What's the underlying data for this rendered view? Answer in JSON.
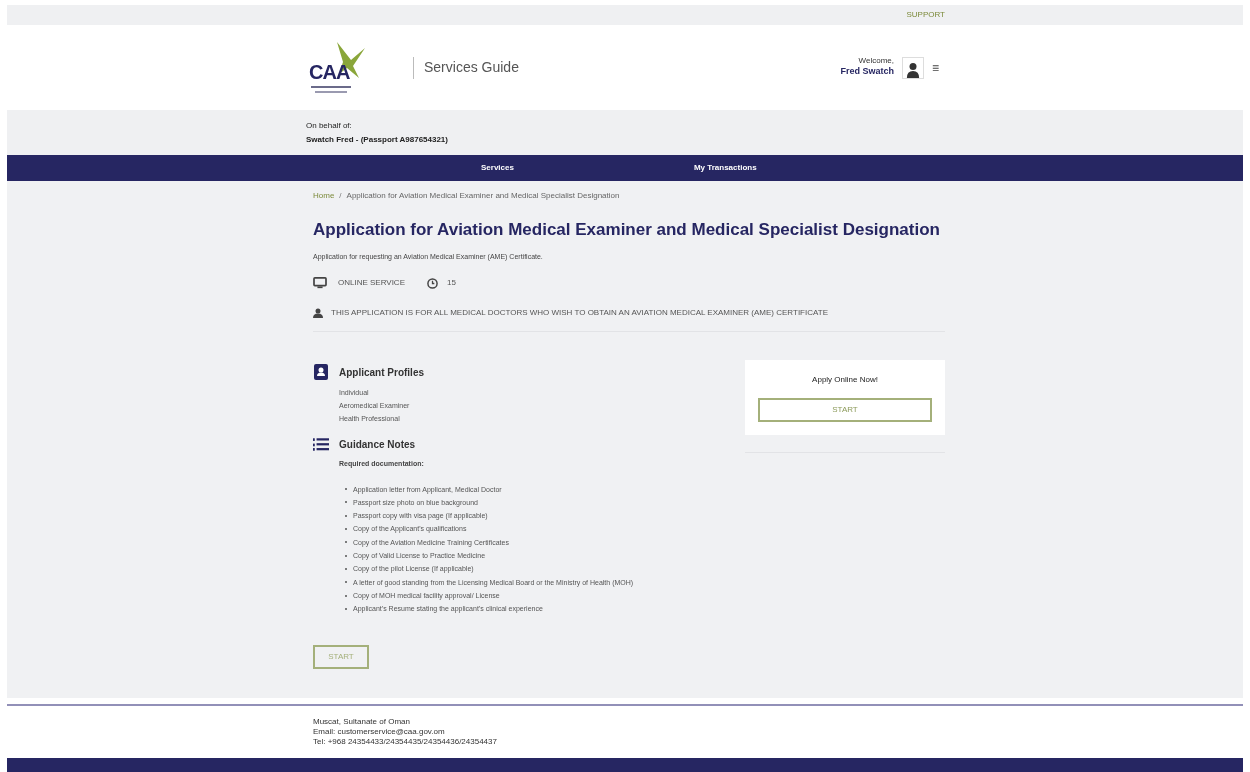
{
  "top_bar": {
    "link": "SUPPORT"
  },
  "header": {
    "logo_text": "CAA",
    "title": "Services Guide",
    "welcome": "Welcome,",
    "user_name": "Fred Swatch",
    "menu_glyph": "≡"
  },
  "behalf": {
    "label": "On behalf of:",
    "value": "Swatch Fred - (Passport A987654321)"
  },
  "nav": [
    {
      "label": "Services"
    },
    {
      "label": "My Transactions"
    }
  ],
  "breadcrumb": {
    "separator": "/",
    "items": [
      "Home",
      "Application for Aviation Medical Examiner and Medical Specialist Designation"
    ]
  },
  "service": {
    "title": "Application for Aviation Medical Examiner and Medical Specialist Designation",
    "description": "Application for requesting an Aviation Medical Examiner (AME) Certificate.",
    "mode": "ONLINE SERVICE",
    "duration": "15",
    "audience": "THIS APPLICATION IS FOR ALL MEDICAL DOCTORS WHO WISH TO OBTAIN AN AVIATION MEDICAL EXAMINER (AME) CERTIFICATE"
  },
  "profiles": {
    "heading": "Applicant Profiles",
    "items": [
      "Individual",
      "Aeromedical Examiner",
      "Health Professional"
    ]
  },
  "guidance": {
    "heading": "Guidance Notes",
    "subheading": "Required documentation:",
    "items": [
      "Application letter from Applicant, Medical Doctor",
      "Passport size photo on blue background",
      "Passport copy with visa page (If applicable)",
      "Copy of the Applicant's qualifications",
      "Copy of the Aviation Medicine Training Certificates",
      "Copy of Valid License to Practice Medicine",
      "Copy of the pilot License (If applicable)",
      "A letter of good standing from the Licensing Medical Board or the Ministry of Health (MOH)",
      "Copy of MOH medical facility approval/ License",
      "Applicant's Resume stating the applicant's clinical experience"
    ]
  },
  "start_button": "START",
  "apply_card": {
    "title": "Apply Online Now!",
    "button": "START"
  },
  "footer": [
    "Muscat, Sultanate of Oman",
    "Email: customerservice@caa.gov.om",
    "Tel: +968 24354433/24354435/24354436/24354437"
  ]
}
